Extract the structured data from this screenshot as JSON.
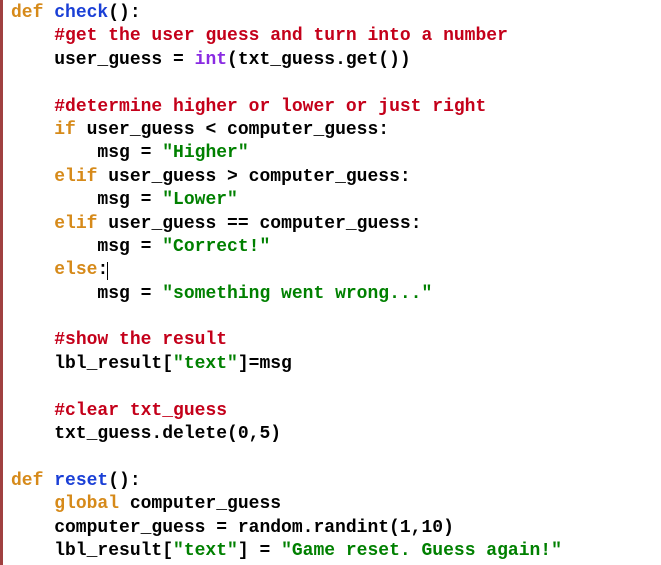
{
  "code": {
    "def1": "def",
    "fn1": "check",
    "sig1": "():",
    "c1": "#get the user guess and turn into a number",
    "l1a": "    user_guess = ",
    "int": "int",
    "l1b": "(txt_guess.get())",
    "c2": "#determine higher or lower or just right",
    "if": "if",
    "l2": " user_guess < computer_guess:",
    "l3a": "        msg = ",
    "s1": "\"Higher\"",
    "elif1": "elif",
    "l4": " user_guess > computer_guess:",
    "l5a": "        msg = ",
    "s2": "\"Lower\"",
    "elif2": "elif",
    "l6": " user_guess == computer_guess:",
    "l7a": "        msg = ",
    "s3": "\"Correct!\"",
    "else": "else",
    "colon": ":",
    "l8a": "        msg = ",
    "s4": "\"something went wrong...\"",
    "c3": "#show the result",
    "l9a": "    lbl_result[",
    "s5": "\"text\"",
    "l9b": "]=msg",
    "c4": "#clear txt_guess",
    "l10": "    txt_guess.delete(0,5)",
    "def2": "def",
    "fn2": "reset",
    "sig2": "():",
    "global": "global",
    "l11": " computer_guess",
    "l12": "    computer_guess = random.randint(1,10)",
    "l13a": "    lbl_result[",
    "s6": "\"text\"",
    "l13b": "] = ",
    "s7": "\"Game reset. Guess again!\""
  }
}
